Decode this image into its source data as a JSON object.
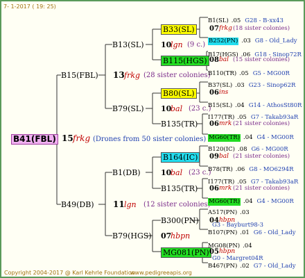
{
  "header": {
    "date": "7- 1-2017 ( 19: 25)"
  },
  "root": {
    "label": "B41(FBL)",
    "num": "15",
    "sire": "frkg",
    "note": "(Drones from 50 sister colonies)"
  },
  "gen1": [
    {
      "label": "B15(FBL)",
      "num": "13",
      "sire": "frkg",
      "note": "(28 sister colonies)"
    },
    {
      "label": "B49(DB)",
      "num": "11",
      "sire": "lgn",
      "note": "(12 sister colonies)"
    }
  ],
  "gen2": [
    {
      "label": "B13(SL)",
      "num": "10",
      "sire": "lgn",
      "note": "(9 c.)"
    },
    {
      "label": "B79(SL)",
      "num": "10",
      "sire": "bal",
      "note": "(23 c.)"
    },
    {
      "label": "B1(DB)",
      "num": "10",
      "sire": "bal",
      "note": "(23 c.)"
    },
    {
      "label": "B79(HGS)",
      "num": "07",
      "sire": "hbpn",
      "note": ""
    }
  ],
  "gen3": [
    {
      "label": "B33(SL)",
      "num": "07",
      "sire": "frkg",
      "note": "(18 sister colonies)"
    },
    {
      "label": "B115(HGS)",
      "num": "08",
      "sire": "bal",
      "note": "(15 sister colonies)"
    },
    {
      "label": "B80(SL)",
      "num": "06",
      "sire": "ins",
      "note": ""
    },
    {
      "label": "B135(TR)",
      "num": "06",
      "sire": "mrk",
      "note": "(21 sister colonies)"
    },
    {
      "label": "B164(IC)",
      "num": "09",
      "sire": "bal",
      "note": "(21 sister colonies)"
    },
    {
      "label": "B135(TR)",
      "num": "06",
      "sire": "mrk",
      "note": "(21 sister colonies)"
    },
    {
      "label": "B300(PN)",
      "num": "04",
      "sire": "hbpn",
      "note": ""
    },
    {
      "label": "MG081(PN)",
      "num": "05",
      "sire": "hbpn",
      "note": ""
    }
  ],
  "gen4": [
    {
      "name": "B1(SL)",
      "num": ".05",
      "ref": "G28 - B-xx43"
    },
    {
      "name": "B252(PN)",
      "num": ".03",
      "ref": "G8 - Old_Lady"
    },
    {
      "name": "B17(HGS)",
      "num": ".06",
      "ref": "G18 - Sinop72R"
    },
    {
      "name": "B110(TR)",
      "num": ".05",
      "ref": "G5 - MG00R"
    },
    {
      "name": "B37(SL)",
      "num": ".03",
      "ref": "G23 - Sinop62R"
    },
    {
      "name": "B15(SL)",
      "num": ".04",
      "ref": "G14 - AthosSt80R"
    },
    {
      "name": "I177(TR)",
      "num": ".05",
      "ref": "G7 - Takab93aR"
    },
    {
      "name": "MG60(TR)",
      "num": ".04",
      "ref": "G4 - MG00R"
    },
    {
      "name": "B120(IC)",
      "num": ".08",
      "ref": "G6 - MG00R"
    },
    {
      "name": "B78(TR)",
      "num": ".06",
      "ref": "G8 - MO6294R"
    },
    {
      "name": "I177(TR)",
      "num": ".05",
      "ref": "G7 - Takab93aR"
    },
    {
      "name": "MG60(TR)",
      "num": ".04",
      "ref": "G4 - MG00R"
    },
    {
      "name": "A517(PN)",
      "num": ".03",
      "ref": "G3 - Bayburt98-3"
    },
    {
      "name": "B107(PN)",
      "num": ".01",
      "ref": "G6 - Old_Lady"
    },
    {
      "name": "MG08(PN)",
      "num": ".04",
      "ref": "G0 - Margret04R"
    },
    {
      "name": "B467(PN)",
      "num": ".02",
      "ref": "G7 - Old_Lady"
    }
  ],
  "footer": {
    "copyright": "Copyright 2004-2017 @ Karl Kehrle Foundation.",
    "site": "www.pedigreeapis.org"
  },
  "colors": {
    "yellow": "#ffff00",
    "green": "#22dd22",
    "cyan": "#22ddee",
    "line": "#333333",
    "sire": "#c00000",
    "note": "#7a2a8a"
  }
}
